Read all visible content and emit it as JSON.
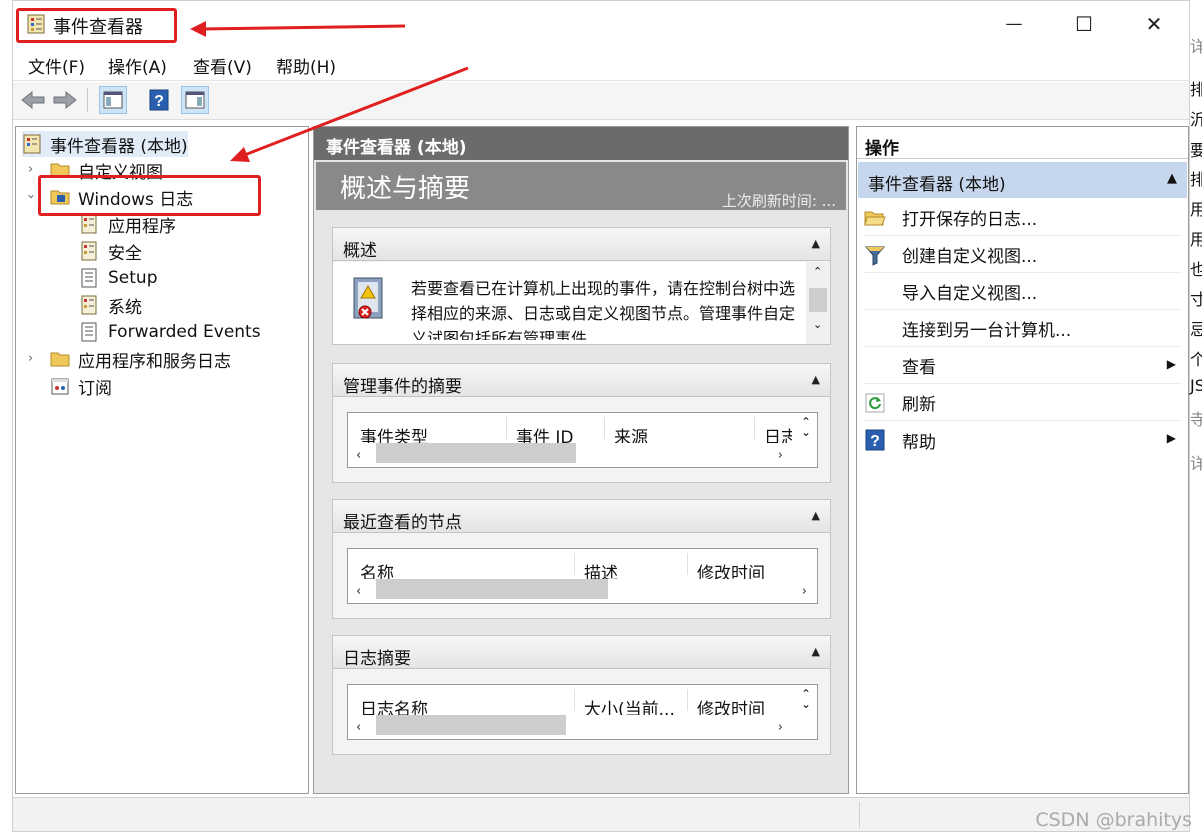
{
  "window": {
    "title": "事件查看器",
    "minimize": "—",
    "maximize": "☐",
    "close": "✕"
  },
  "menubar": [
    "文件(F)",
    "操作(A)",
    "查看(V)",
    "帮助(H)"
  ],
  "toolbar": [
    "back-arrow-icon",
    "forward-arrow-icon",
    "show-hide-tree-icon",
    "help-icon",
    "show-hide-actions-icon"
  ],
  "tree": {
    "root": "事件查看器 (本地)",
    "custom_views": "自定义视图",
    "windows_logs": "Windows 日志",
    "logs": [
      "应用程序",
      "安全",
      "Setup",
      "系统",
      "Forwarded Events"
    ],
    "app_service_logs": "应用程序和服务日志",
    "subscriptions": "订阅"
  },
  "center": {
    "header": "事件查看器 (本地)",
    "overview_title": "概述与摘要",
    "last_refresh": "上次刷新时间: ...",
    "overview": {
      "title": "概述",
      "text": "若要查看已在计算机上出现的事件，请在控制台树中选择相应的来源、日志或自定义视图节点。管理事件自定义试图包括所有管理事件"
    },
    "admin_events": {
      "title": "管理事件的摘要",
      "columns": [
        "事件类型",
        "事件 ID",
        "来源",
        "日志"
      ]
    },
    "recent_nodes": {
      "title": "最近查看的节点",
      "columns": [
        "名称",
        "描述",
        "修改时间"
      ]
    },
    "log_summary": {
      "title": "日志摘要",
      "columns": [
        "日志名称",
        "大小(当前...",
        "修改时间"
      ]
    }
  },
  "actions": {
    "title": "操作",
    "section": "事件查看器 (本地)",
    "items": [
      {
        "label": "打开保存的日志...",
        "icon": "open-folder-icon"
      },
      {
        "label": "创建自定义视图...",
        "icon": "filter-icon"
      },
      {
        "label": "导入自定义视图...",
        "icon": ""
      },
      {
        "label": "连接到另一台计算机...",
        "icon": ""
      },
      {
        "label": "查看",
        "icon": "",
        "submenu": true
      },
      {
        "label": "刷新",
        "icon": "refresh-icon"
      },
      {
        "label": "帮助",
        "icon": "help-icon",
        "submenu": true
      }
    ]
  },
  "watermark": "CSDN @brahitys",
  "background_fragments": [
    "详",
    "排",
    "沂",
    "要",
    "排",
    "用",
    "用",
    "也",
    "寸",
    "忌",
    "个",
    "JS",
    "寺",
    "详"
  ],
  "annotation_color": "#e02020"
}
